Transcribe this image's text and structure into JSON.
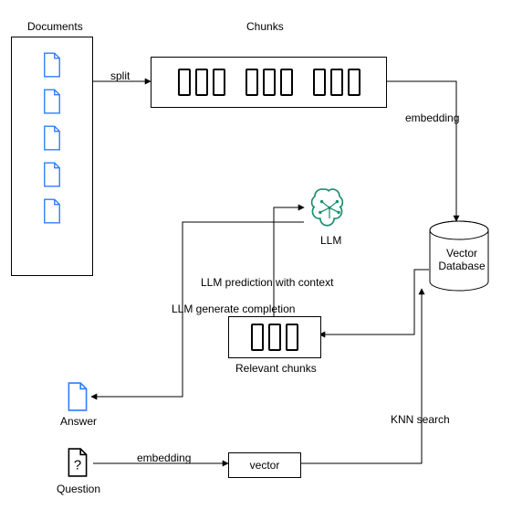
{
  "labels": {
    "documents": "Documents",
    "chunks": "Chunks",
    "split": "split",
    "embedding_top": "embedding",
    "vector_db": "Vector\nDatabase",
    "llm": "LLM",
    "llm_pred": "LLM prediction with context",
    "llm_gen": "LLM generate completion",
    "relevant_chunks": "Relevant chunks",
    "answer": "Answer",
    "question": "Question",
    "embedding_bottom": "embedding",
    "vector": "vector",
    "knn": "KNN search"
  },
  "icons": {
    "document": "document-icon",
    "answer_doc": "document-icon",
    "question_doc": "question-document-icon",
    "llm_brain": "ai-brain-icon"
  },
  "diagram": {
    "type": "flow",
    "nodes": [
      {
        "id": "documents",
        "label": "Documents"
      },
      {
        "id": "chunks",
        "label": "Chunks"
      },
      {
        "id": "vector_db",
        "label": "Vector Database"
      },
      {
        "id": "question",
        "label": "Question"
      },
      {
        "id": "vector",
        "label": "vector"
      },
      {
        "id": "relevant_chunks",
        "label": "Relevant chunks"
      },
      {
        "id": "llm",
        "label": "LLM"
      },
      {
        "id": "answer",
        "label": "Answer"
      }
    ],
    "edges": [
      {
        "from": "documents",
        "to": "chunks",
        "label": "split"
      },
      {
        "from": "chunks",
        "to": "vector_db",
        "label": "embedding"
      },
      {
        "from": "question",
        "to": "vector",
        "label": "embedding"
      },
      {
        "from": "vector",
        "to": "vector_db",
        "label": "KNN search"
      },
      {
        "from": "vector_db",
        "to": "relevant_chunks",
        "label": ""
      },
      {
        "from": "relevant_chunks",
        "to": "llm",
        "label": "LLM prediction with context"
      },
      {
        "from": "llm",
        "to": "answer",
        "label": "LLM generate completion"
      }
    ]
  }
}
